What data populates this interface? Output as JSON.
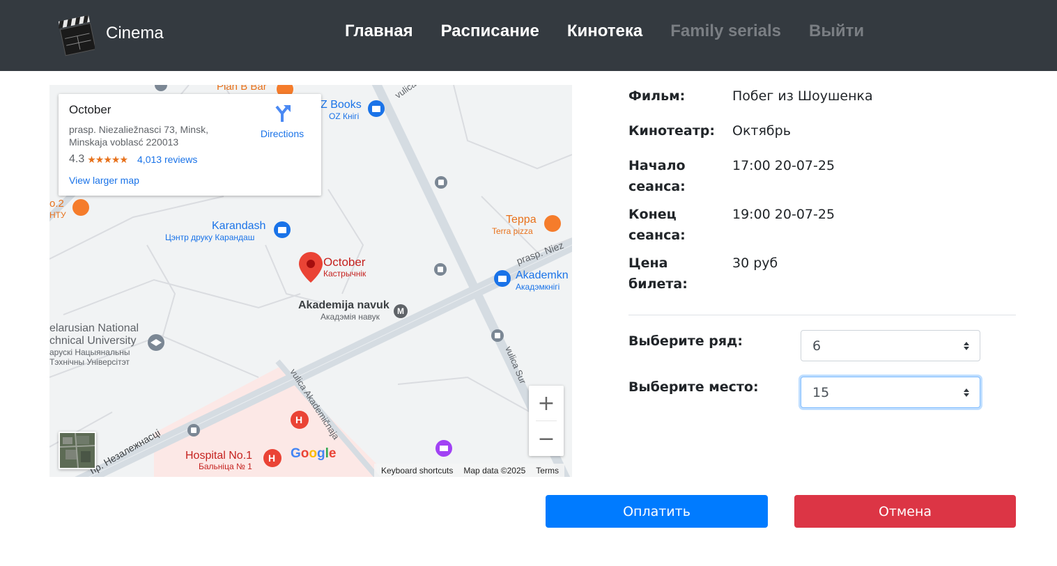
{
  "navbar": {
    "brand": "Cinema",
    "links": [
      {
        "label": "Главная",
        "state": "active"
      },
      {
        "label": "Расписание",
        "state": "active"
      },
      {
        "label": "Кинотека",
        "state": "active"
      },
      {
        "label": "Family serials",
        "state": "muted"
      },
      {
        "label": "Выйти",
        "state": "muted"
      }
    ]
  },
  "map": {
    "place": {
      "name": "October",
      "address_line1": "prasp. Niezaliežnasci 73, Minsk,",
      "address_line2": "Minskaja voblasć 220013",
      "rating": "4.3",
      "stars": "★★★★★",
      "reviews": "4,013 reviews",
      "larger_map": "View larger map",
      "directions": "Directions"
    },
    "labels": {
      "plan_b": "Plan B Bar",
      "z_books": "Z Books",
      "oz_knigi": "OZ Кнігі",
      "vulica_top": "vulica Ku",
      "no2": "o.2",
      "ntu": "НТУ",
      "karandash": "Karandash",
      "karandash_ru": "Цэнтр друку Карандаш",
      "teppa": "Teppa",
      "terra_pizza": "Terra pizza",
      "prasp_niez": "prasp. Niez",
      "october_pin": "October",
      "october_pin_ru": "Кастрычнік",
      "akademkniga": "Akademkn",
      "akademkniga_ru": "Акадэмкнігі",
      "akad_navuk": "Akademija navuk",
      "akad_navuk_ru": "Акадэмія навук",
      "metro": "M",
      "bntu1": "elarusian National",
      "bntu2": "chnical University",
      "bntu3": "арускі Нацыянальны",
      "bntu4": "Тэхнічны Універсітэт",
      "vulica_akad": "vulica Akademičnaja",
      "vulica_sur": "vulica Sur",
      "nezalezhnasci": "пр. Незалежнасці",
      "hospital": "Hospital No.1",
      "hospital_ru": "Бальніца № 1",
      "hospital_icon": "H"
    },
    "google": "Google",
    "zoom_in": "+",
    "zoom_out": "−",
    "attribution": {
      "shortcuts": "Keyboard shortcuts",
      "data": "Map data ©2025",
      "terms": "Terms"
    }
  },
  "details": {
    "film_label": "Фильм:",
    "film_value": "Побег из Шоушенка",
    "cinema_label": "Кинотеатр:",
    "cinema_value": "Октябрь",
    "start_label": "Начало сеанса:",
    "start_value": "17:00 20-07-25",
    "end_label": "Конец сеанса:",
    "end_value": "19:00 20-07-25",
    "price_label": "Цена билета:",
    "price_value": "30 руб"
  },
  "form": {
    "row_label": "Выберите ряд:",
    "row_value": "6",
    "seat_label": "Выберите место:",
    "seat_value": "15"
  },
  "buttons": {
    "pay": "Оплатить",
    "cancel": "Отмена"
  },
  "colors": {
    "navbar": "#343a40",
    "primary": "#007bff",
    "danger": "#dc3545",
    "map_bg": "#f1f3f4",
    "map_road": "#d5dce2",
    "hospital_zone": "#fce8e6",
    "pin_red": "#ea4335",
    "map_link": "#1a73e8"
  },
  "icons": [
    "clapperboard-logo",
    "directions-icon",
    "location-pin-icon",
    "shop-icon",
    "food-icon",
    "bus-stop-icon",
    "metro-icon",
    "university-icon",
    "hospital-icon",
    "museum-icon"
  ]
}
